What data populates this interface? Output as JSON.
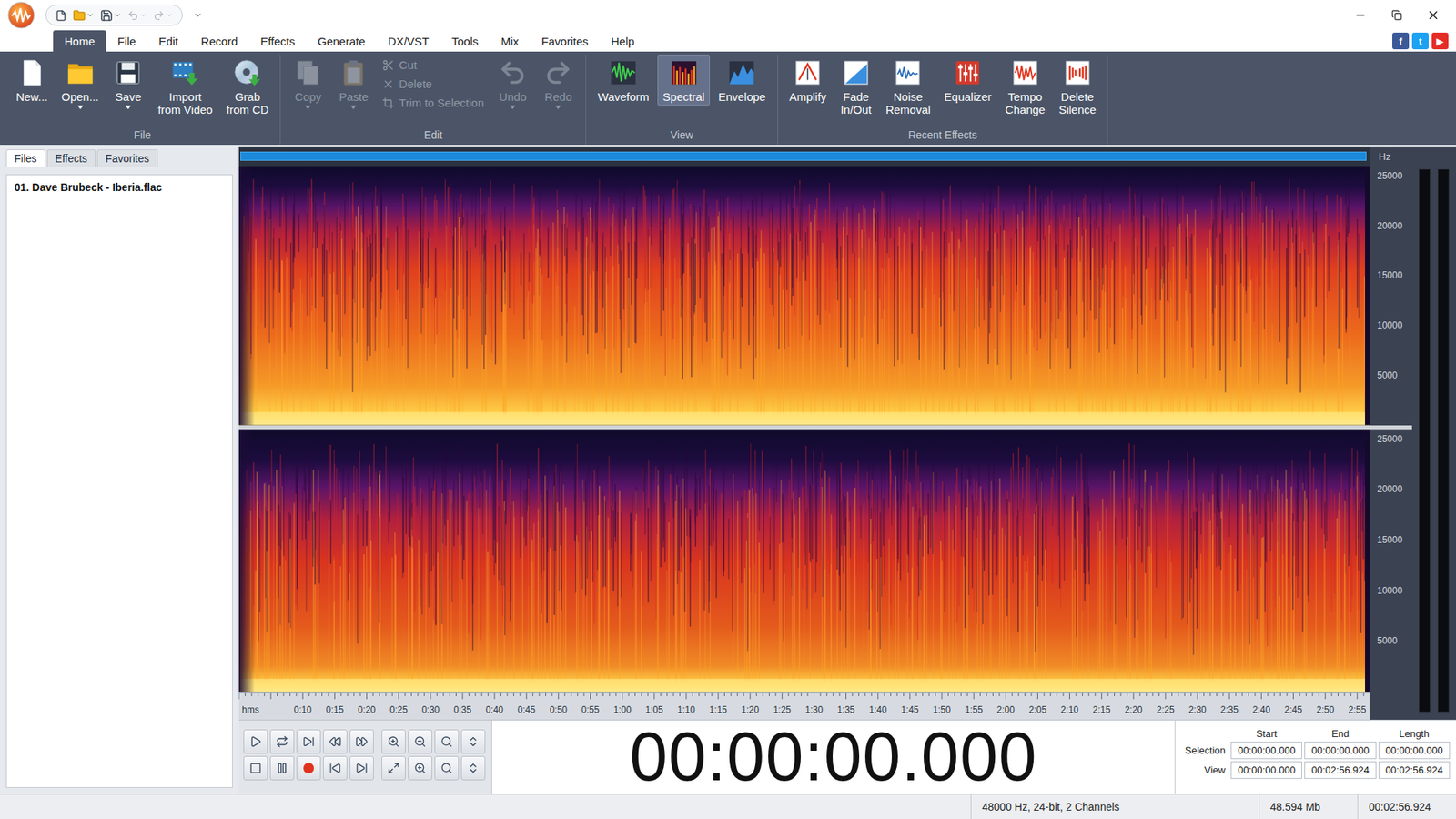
{
  "menu": [
    {
      "label": "Home",
      "selected": true
    },
    {
      "label": "File",
      "selected": false
    },
    {
      "label": "Edit",
      "selected": false
    },
    {
      "label": "Record",
      "selected": false
    },
    {
      "label": "Effects",
      "selected": false
    },
    {
      "label": "Generate",
      "selected": false
    },
    {
      "label": "DX/VST",
      "selected": false
    },
    {
      "label": "Tools",
      "selected": false
    },
    {
      "label": "Mix",
      "selected": false
    },
    {
      "label": "Favorites",
      "selected": false
    },
    {
      "label": "Help",
      "selected": false
    }
  ],
  "social": [
    {
      "label": "f",
      "color": "#3b5998"
    },
    {
      "label": "t",
      "color": "#1da1f2"
    },
    {
      "label": "▶",
      "color": "#e52d27"
    }
  ],
  "ribbon": {
    "groups": [
      {
        "label": "File",
        "items": [
          {
            "label": "New...",
            "kind": "large",
            "disabled": false,
            "selected": false,
            "dropdown": false
          },
          {
            "label": "Open...",
            "kind": "large",
            "disabled": false,
            "selected": false,
            "dropdown": true
          },
          {
            "label": "Save",
            "kind": "large",
            "disabled": false,
            "selected": false,
            "dropdown": true
          },
          {
            "label": "Import\nfrom Video",
            "kind": "large",
            "disabled": false,
            "selected": false,
            "dropdown": false
          },
          {
            "label": "Grab\nfrom CD",
            "kind": "large",
            "disabled": false,
            "selected": false,
            "dropdown": false
          }
        ]
      },
      {
        "label": "Edit",
        "items": [
          {
            "label": "Copy",
            "kind": "large",
            "disabled": true,
            "selected": false,
            "dropdown": true
          },
          {
            "label": "Paste",
            "kind": "large",
            "disabled": true,
            "selected": false,
            "dropdown": true
          },
          {
            "label": "Cut",
            "kind": "small",
            "disabled": true,
            "selected": false,
            "dropdown": false
          },
          {
            "label": "Delete",
            "kind": "small",
            "disabled": true,
            "selected": false,
            "dropdown": false
          },
          {
            "label": "Trim to Selection",
            "kind": "small",
            "disabled": true,
            "selected": false,
            "dropdown": false
          },
          {
            "label": "Undo",
            "kind": "large",
            "disabled": true,
            "selected": false,
            "dropdown": true
          },
          {
            "label": "Redo",
            "kind": "large",
            "disabled": true,
            "selected": false,
            "dropdown": true
          }
        ]
      },
      {
        "label": "View",
        "items": [
          {
            "label": "Waveform",
            "kind": "large",
            "disabled": false,
            "selected": false,
            "dropdown": false
          },
          {
            "label": "Spectral",
            "kind": "large",
            "disabled": false,
            "selected": true,
            "dropdown": false
          },
          {
            "label": "Envelope",
            "kind": "large",
            "disabled": false,
            "selected": false,
            "dropdown": false
          }
        ]
      },
      {
        "label": "Recent Effects",
        "items": [
          {
            "label": "Amplify",
            "kind": "large",
            "disabled": false,
            "selected": false,
            "dropdown": false
          },
          {
            "label": "Fade\nIn/Out",
            "kind": "large",
            "disabled": false,
            "selected": false,
            "dropdown": false
          },
          {
            "label": "Noise\nRemoval",
            "kind": "large",
            "disabled": false,
            "selected": false,
            "dropdown": false
          },
          {
            "label": "Equalizer",
            "kind": "large",
            "disabled": false,
            "selected": false,
            "dropdown": false
          },
          {
            "label": "Tempo\nChange",
            "kind": "large",
            "disabled": false,
            "selected": false,
            "dropdown": false
          },
          {
            "label": "Delete\nSilence",
            "kind": "large",
            "disabled": false,
            "selected": false,
            "dropdown": false
          }
        ]
      }
    ]
  },
  "side_tabs": [
    {
      "label": "Files",
      "selected": true
    },
    {
      "label": "Effects",
      "selected": false
    },
    {
      "label": "Favorites",
      "selected": false
    }
  ],
  "files": [
    {
      "label": "01. Dave Brubeck - Iberia.flac",
      "selected": true
    }
  ],
  "editor": {
    "hz_unit": "Hz",
    "channels": [
      {
        "ticks": [
          "25000",
          "20000",
          "15000",
          "10000",
          "5000"
        ]
      },
      {
        "ticks": [
          "25000",
          "20000",
          "15000",
          "10000",
          "5000"
        ]
      }
    ],
    "ruler": {
      "unit": "hms",
      "ticks": [
        "0:10",
        "0:15",
        "0:20",
        "0:25",
        "0:30",
        "0:35",
        "0:40",
        "0:45",
        "0:50",
        "0:55",
        "1:00",
        "1:05",
        "1:10",
        "1:15",
        "1:20",
        "1:25",
        "1:30",
        "1:35",
        "1:40",
        "1:45",
        "1:50",
        "1:55",
        "2:00",
        "2:05",
        "2:10",
        "2:15",
        "2:20",
        "2:25",
        "2:30",
        "2:35",
        "2:40",
        "2:45",
        "2:50",
        "2:55"
      ]
    },
    "meters": [
      {
        "level": 0
      },
      {
        "level": 0
      }
    ]
  },
  "clock": "00:00:00.000",
  "selection_table": {
    "columns": [
      "Start",
      "End",
      "Length"
    ],
    "rows": [
      {
        "label": "Selection",
        "cells": [
          "00:00:00.000",
          "00:00:00.000",
          "00:00:00.000"
        ]
      },
      {
        "label": "View",
        "cells": [
          "00:00:00.000",
          "00:02:56.924",
          "00:02:56.924"
        ]
      }
    ]
  },
  "status_bar": [
    "48000 Hz, 24-bit, 2 Channels",
    "48.594 Mb",
    "00:02:56.924"
  ]
}
